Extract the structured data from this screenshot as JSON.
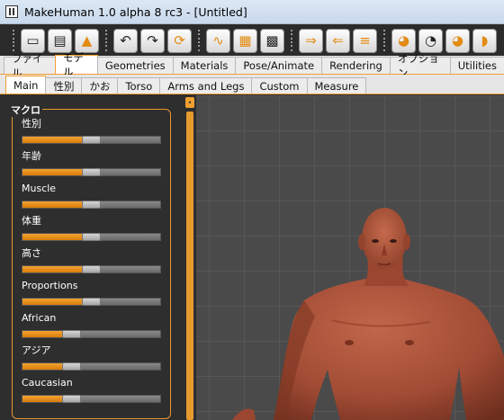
{
  "window": {
    "title": "MakeHuman 1.0 alpha 8 rc3 - [Untitled]"
  },
  "toolbar": {
    "buttons": [
      "load-icon",
      "save-icon",
      "export-icon",
      "undo-icon",
      "redo-icon",
      "reset-icon",
      "smooth-icon",
      "wireframe-icon",
      "background-icon",
      "front-view-icon",
      "back-view-icon",
      "side-view-icon",
      "left-view-icon",
      "right-view-icon",
      "top-view-icon",
      "bottom-view-icon"
    ]
  },
  "main_tabs": [
    {
      "label": "ファイル",
      "active": false
    },
    {
      "label": "モデル",
      "active": true
    },
    {
      "label": "Geometries",
      "active": false
    },
    {
      "label": "Materials",
      "active": false
    },
    {
      "label": "Pose/Animate",
      "active": false
    },
    {
      "label": "Rendering",
      "active": false
    },
    {
      "label": "オプション",
      "active": false
    },
    {
      "label": "Utilities",
      "active": false
    }
  ],
  "sub_tabs": [
    {
      "label": "Main",
      "active": true
    },
    {
      "label": "性別",
      "active": false
    },
    {
      "label": "かお",
      "active": false
    },
    {
      "label": "Torso",
      "active": false
    },
    {
      "label": "Arms and Legs",
      "active": false
    },
    {
      "label": "Custom",
      "active": false
    },
    {
      "label": "Measure",
      "active": false
    }
  ],
  "macro_panel": {
    "title": "マクロ",
    "sliders": [
      {
        "label": "性別",
        "value": 0.5
      },
      {
        "label": "年齢",
        "value": 0.5
      },
      {
        "label": "Muscle",
        "value": 0.5
      },
      {
        "label": "体重",
        "value": 0.5
      },
      {
        "label": "高さ",
        "value": 0.5
      },
      {
        "label": "Proportions",
        "value": 0.5
      },
      {
        "label": "African",
        "value": 0.333
      },
      {
        "label": "アジア",
        "value": 0.333
      },
      {
        "label": "Caucasian",
        "value": 0.333
      }
    ]
  },
  "colors": {
    "accent": "#f0a030",
    "skin": "#a8503a",
    "viewport_bg": "#4a4a4a"
  }
}
